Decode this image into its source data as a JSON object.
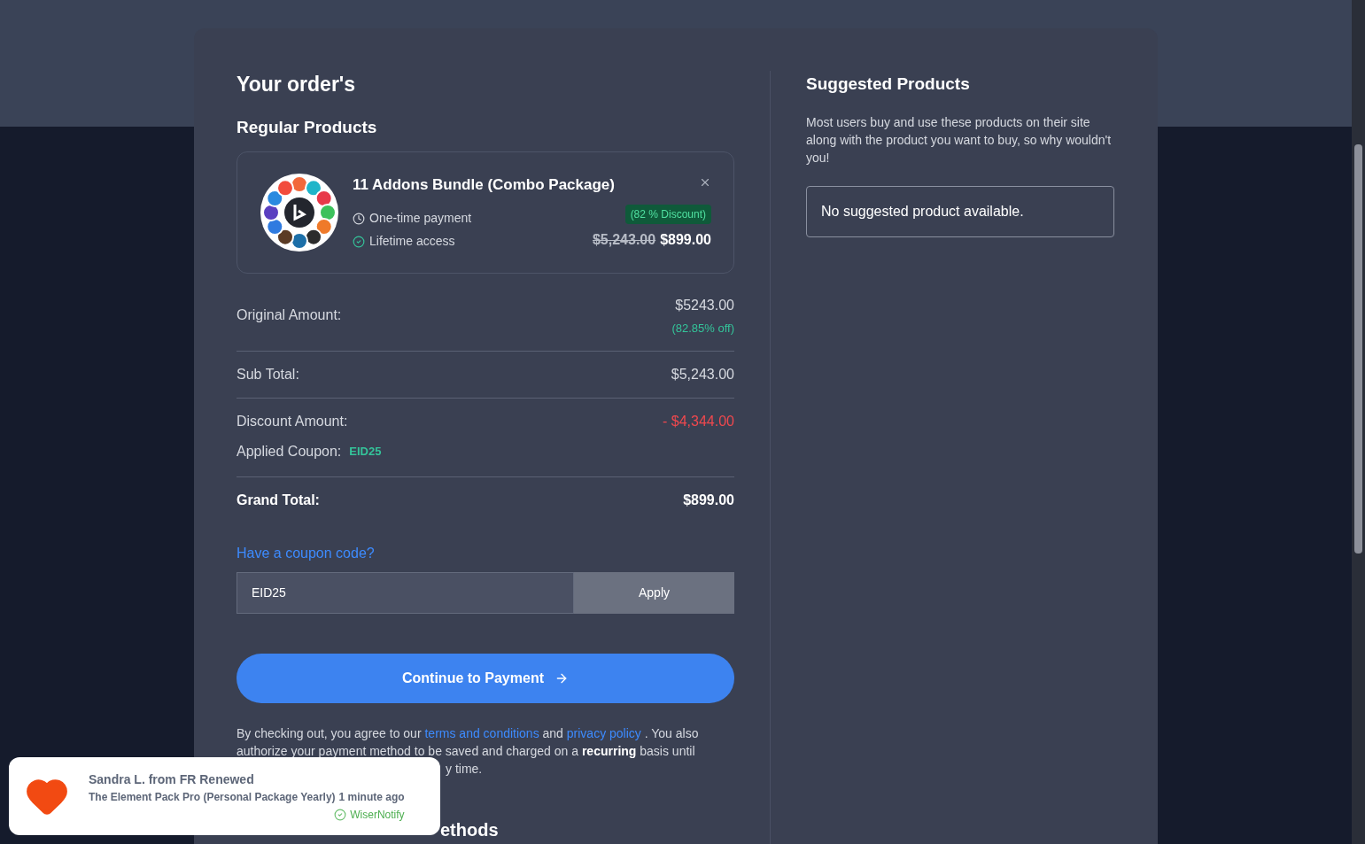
{
  "order": {
    "title": "Your order's",
    "section": "Regular Products",
    "product": {
      "name": "11 Addons Bundle (Combo Package)",
      "features": [
        {
          "kind": "clock",
          "text": "One-time payment"
        },
        {
          "kind": "check",
          "text": "Lifetime access"
        }
      ],
      "discount_badge": "(82 % Discount)",
      "old_price": "$5,243.00",
      "price": "$899.00"
    },
    "original_amount": {
      "label": "Original Amount:",
      "value": "$5243.00",
      "note": "(82.85% off)"
    },
    "sub_total": {
      "label": "Sub Total:",
      "value": "$5,243.00"
    },
    "discount": {
      "label": "Discount Amount:",
      "value": "- $4,344.00"
    },
    "applied_coupon": {
      "label": "Applied Coupon:",
      "code": "EID25"
    },
    "grand_total": {
      "label": "Grand Total:",
      "value": "$899.00"
    },
    "coupon": {
      "link": "Have a coupon code?",
      "value": "EID25",
      "button": "Apply"
    },
    "continue_button": "Continue to Payment",
    "consent": [
      {
        "kind": "text",
        "text": "By checking out, you agree to our "
      },
      {
        "kind": "link",
        "text": "terms and conditions"
      },
      {
        "kind": "text",
        "text": " and "
      },
      {
        "kind": "link",
        "text": "privacy policy"
      },
      {
        "kind": "text",
        "text": " . You also authorize your payment method to be saved and charged on a "
      },
      {
        "kind": "bold",
        "text": "recurring"
      },
      {
        "kind": "text",
        "text": " basis until"
      }
    ],
    "consent_tail": "y time.",
    "next_heading": "ethods"
  },
  "suggested": {
    "title": "Suggested Products",
    "description": "Most users buy and use these products on their site along with the product you want to buy, so why wouldn't you!",
    "empty": "No suggested product available."
  },
  "toast": {
    "headline": "Sandra L. from FR Renewed",
    "detail": "The Element Pack Pro (Personal Package Yearly)",
    "time": "1 minute ago",
    "source": "WiserNotify"
  }
}
